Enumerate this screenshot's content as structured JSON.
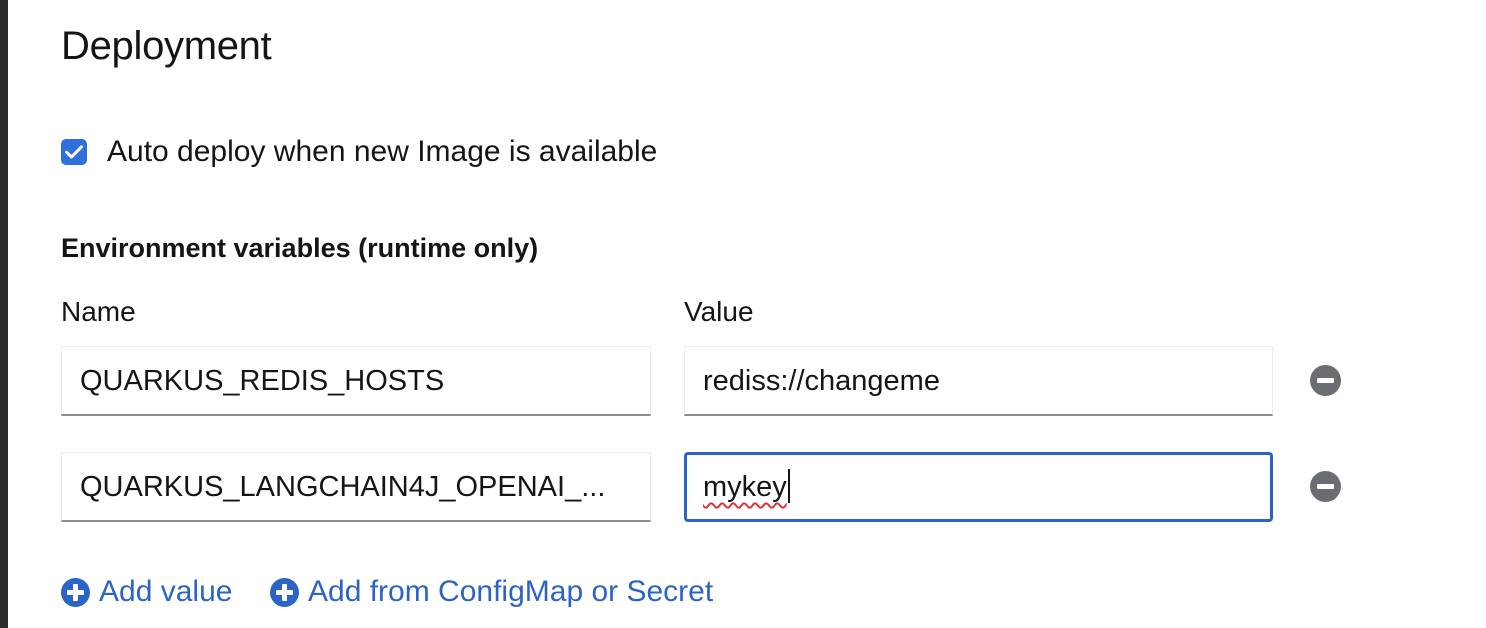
{
  "section": {
    "title": "Deployment"
  },
  "auto_deploy": {
    "checked": true,
    "label": "Auto deploy when new Image is available"
  },
  "env": {
    "title": "Environment variables (runtime only)",
    "name_header": "Name",
    "value_header": "Value",
    "rows": [
      {
        "name": "QUARKUS_REDIS_HOSTS",
        "value": "rediss://changeme"
      },
      {
        "name": "QUARKUS_LANGCHAIN4J_OPENAI_...",
        "value": "mykey"
      }
    ]
  },
  "actions": {
    "add_value": "Add value",
    "add_from_configmap": "Add from ConfigMap or Secret"
  },
  "colors": {
    "accent": "#2b64c5",
    "checkbox": "#2f6fde",
    "remove_icon": "#6a6e73"
  }
}
